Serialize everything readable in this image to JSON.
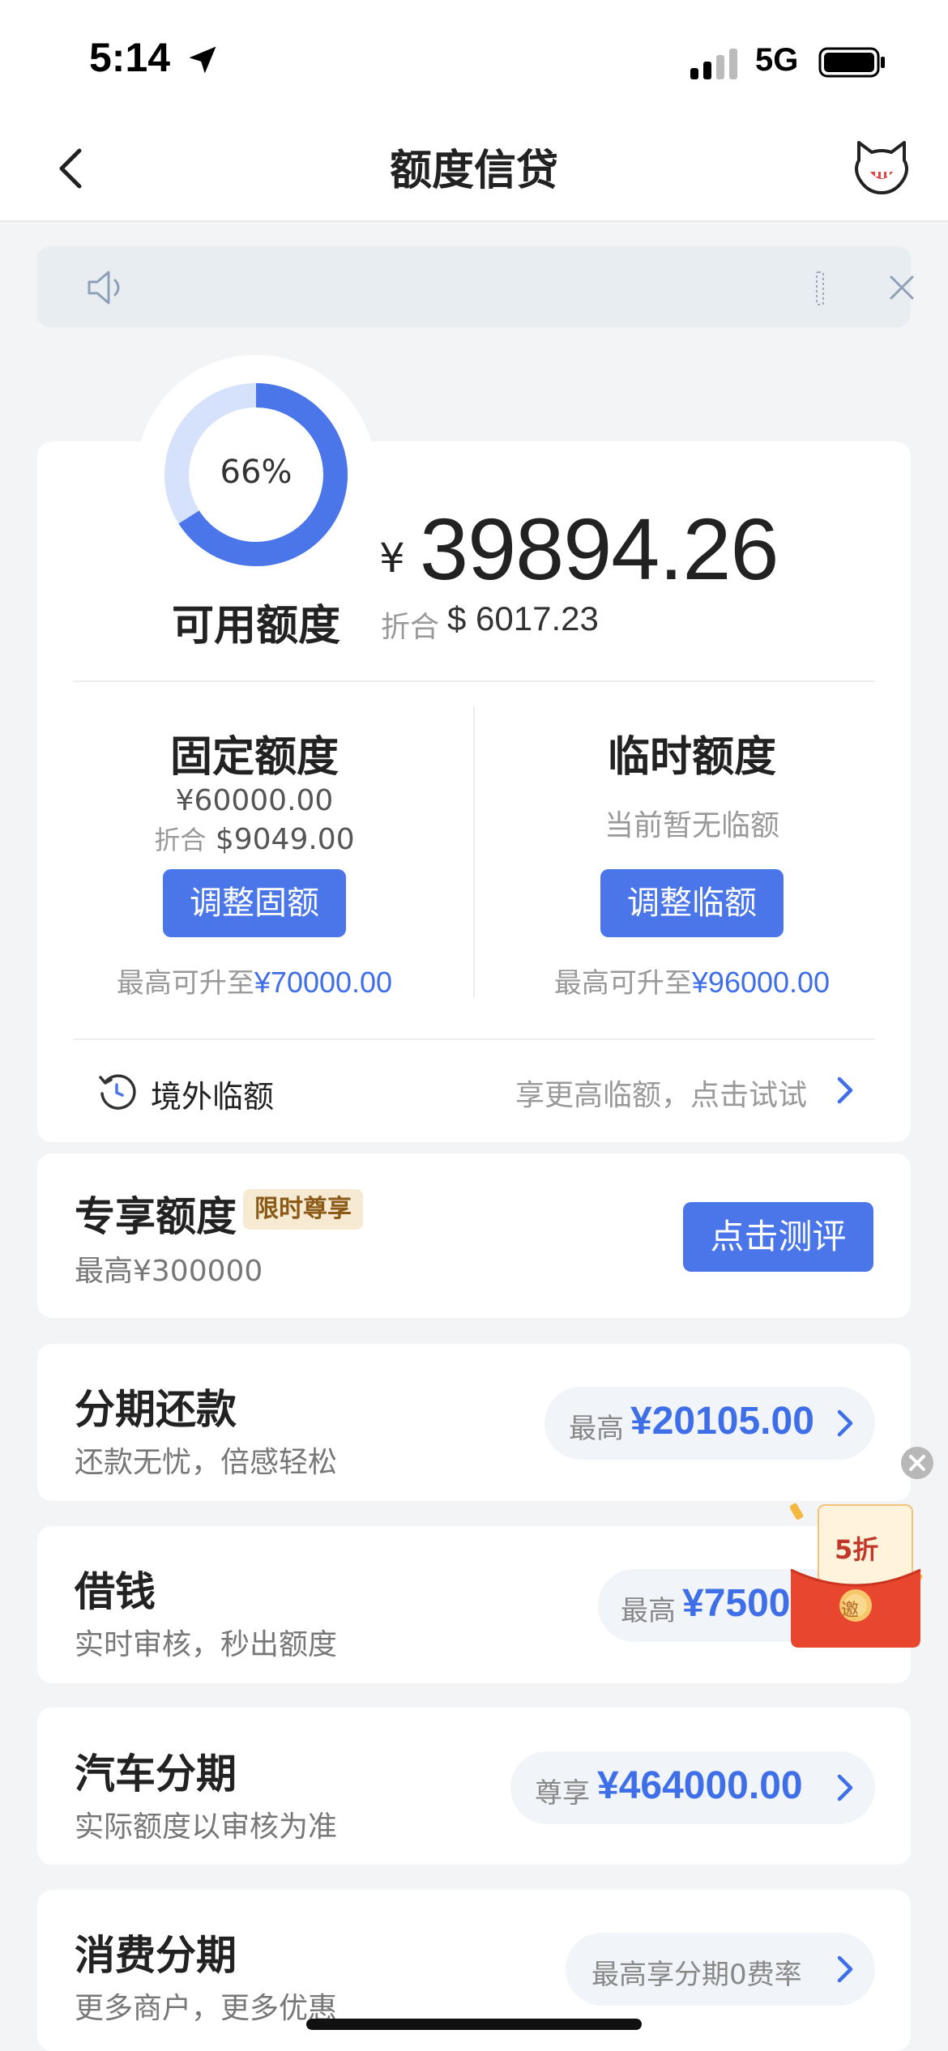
{
  "status_bar": {
    "time": "5:14",
    "network": "5G"
  },
  "nav": {
    "title": "额度信贷"
  },
  "credit": {
    "percent_text": "66%",
    "percent_value": 0.66,
    "available_label": "可用额度",
    "currency_symbol": "¥",
    "available_amount": "39894.26",
    "converted_label": "折合",
    "converted_amount": "$ 6017.23"
  },
  "fixed": {
    "title": "固定额度",
    "amount": "¥60000.00",
    "converted_label": "折合",
    "converted_amount": "$9049.00",
    "button": "调整固额",
    "max_label": "最高可升至",
    "max_value": "¥70000.00"
  },
  "temporary": {
    "title": "临时额度",
    "status": "当前暂无临额",
    "button": "调整临额",
    "max_label": "最高可升至",
    "max_value": "¥96000.00"
  },
  "overseas": {
    "label": "境外临额",
    "hint": "享更高临额，点击试试"
  },
  "exclusive": {
    "title": "专享额度",
    "badge": "限时尊享",
    "sub": "最高¥300000",
    "button": "点击测评"
  },
  "products": [
    {
      "title": "分期还款",
      "sub": "还款无忧，倍感轻松",
      "prefix": "最高",
      "value": "¥20105.00"
    },
    {
      "title": "借钱",
      "sub": "实时审核，秒出额度",
      "prefix": "最高",
      "value": "¥7500"
    },
    {
      "title": "汽车分期",
      "sub": "实际额度以审核为准",
      "prefix": "尊享",
      "value": "¥464000.00"
    },
    {
      "title": "消费分期",
      "sub": "更多商户，更多优惠",
      "text": "最高享分期0费率"
    }
  ],
  "promo": {
    "discount": "5折",
    "invite": "邀"
  },
  "colors": {
    "accent": "#4a76ea",
    "ring_track": "#d6e2fb",
    "badge_bg": "#f7ead2"
  }
}
